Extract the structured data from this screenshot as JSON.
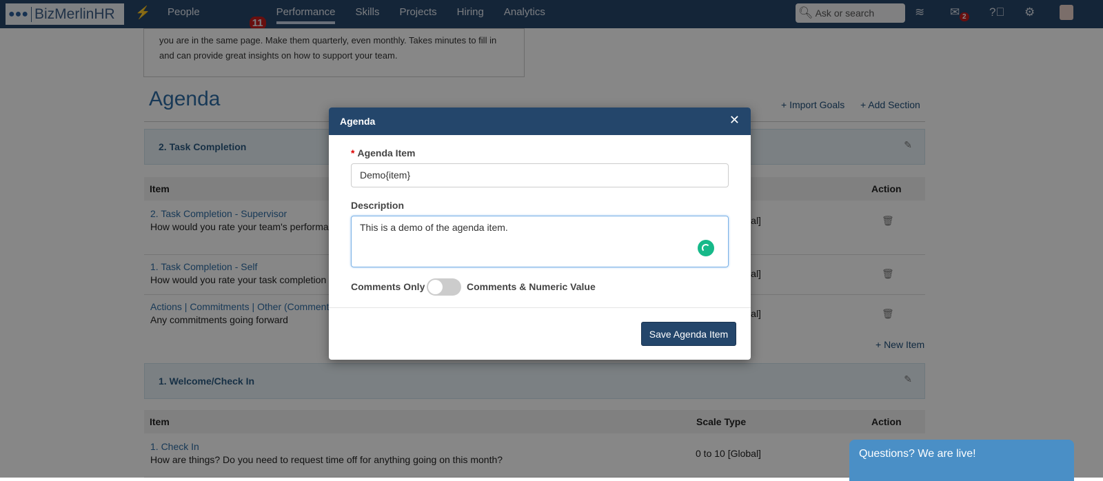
{
  "nav": {
    "logo": "BizMerlinHR",
    "items": [
      "People",
      "Performance",
      "Skills",
      "Projects",
      "Hiring",
      "Analytics"
    ],
    "people_badge": "11",
    "search_placeholder": "Ask or search",
    "mail_badge": "2"
  },
  "intro": {
    "text": "you are in the same page. Make them quarterly, even monthly. Takes minutes to fill in and can provide great insights on how to support your team."
  },
  "page": {
    "title": "Agenda",
    "import_goals": "Import Goals",
    "add_section": "Add Section",
    "new_item": "+ New Item",
    "sections": [
      {
        "title": "2. Task Completion",
        "col_item": "Item",
        "col_action": "Action",
        "rows": [
          {
            "title": "2. Task Completion - Supervisor",
            "desc": "How would you rate your team's performance ... examples?",
            "scale": "0 to 10 [Global]"
          },
          {
            "title": "1. Task Completion - Self",
            "desc": "How would you rate your task completion",
            "scale": "0 to 10 [Global]"
          },
          {
            "title": "Actions | Commitments | Other (Comments)",
            "desc": "Any commitments going forward",
            "scale": "0 to 10 [Global]"
          }
        ]
      },
      {
        "title": "1. Welcome/Check In",
        "col_item": "Item",
        "col_scale": "Scale Type",
        "col_action": "Action",
        "rows": [
          {
            "title": "1. Check In",
            "desc": "How are things? Do you need to request time off for anything going on this month?",
            "scale": "0 to 10 [Global]"
          }
        ]
      }
    ]
  },
  "modal": {
    "title": "Agenda",
    "agenda_label": "Agenda Item",
    "agenda_value": "Demo{item}",
    "desc_label": "Description",
    "desc_value": "This is a demo of the agenda item.",
    "toggle_left": "Comments Only",
    "toggle_right": "Comments & Numeric Value",
    "toggle_on": false,
    "save": "Save Agenda Item"
  },
  "chat": {
    "label": "Questions? We are live!"
  }
}
